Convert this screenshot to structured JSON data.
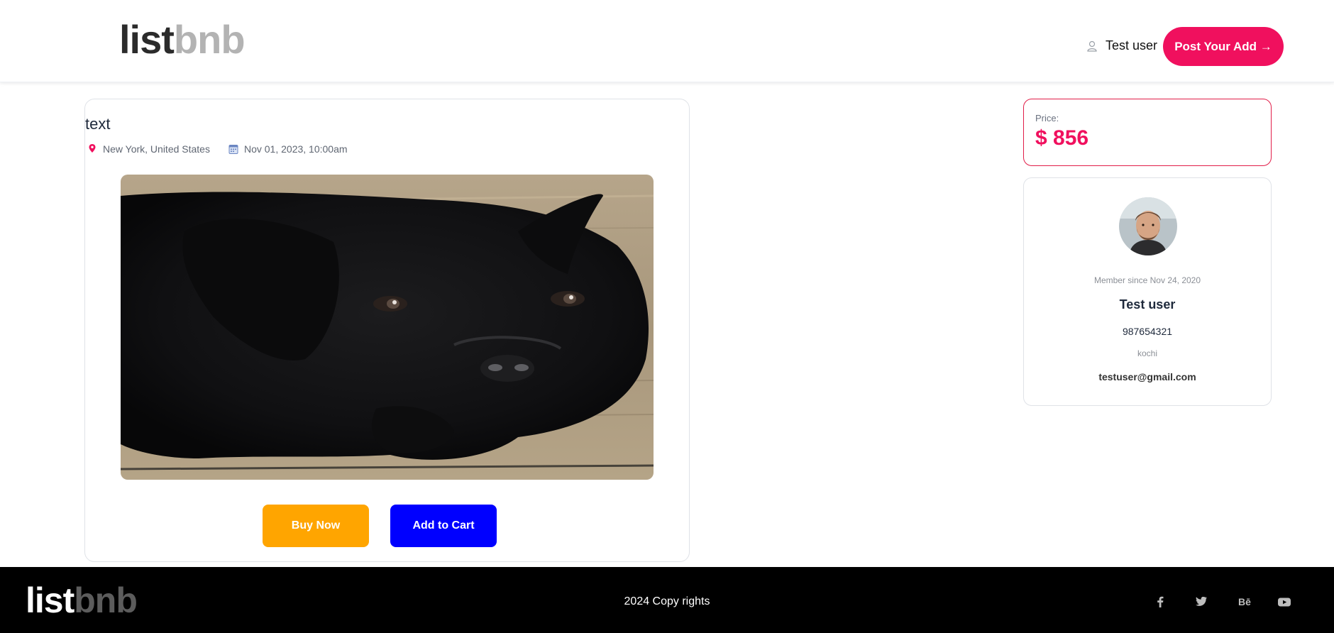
{
  "header": {
    "logo": {
      "part1": "list",
      "part2": "bnb"
    },
    "user_name": "Test user",
    "post_button": "Post Your Add →"
  },
  "listing": {
    "title": "text",
    "location": "New York, United States",
    "date": "Nov 01, 2023, 10:00am",
    "buy_button": "Buy Now",
    "cart_button": "Add to Cart"
  },
  "price": {
    "label": "Price:",
    "value": "$ 856"
  },
  "seller": {
    "member_since": "Member since Nov 24, 2020",
    "name": "Test user",
    "phone": "987654321",
    "city": "kochi",
    "email": "testuser@gmail.com"
  },
  "footer": {
    "logo": {
      "part1": "list",
      "part2": "bnb"
    },
    "copyright": "2024 Copy rights",
    "behance": "Bē"
  },
  "colors": {
    "brand": "#f0105e",
    "buy": "#ffa500",
    "cart": "#0000ff"
  },
  "icons": [
    "user-icon",
    "map-pin-icon",
    "calendar-icon",
    "facebook-icon",
    "twitter-icon",
    "behance-icon",
    "youtube-icon"
  ]
}
